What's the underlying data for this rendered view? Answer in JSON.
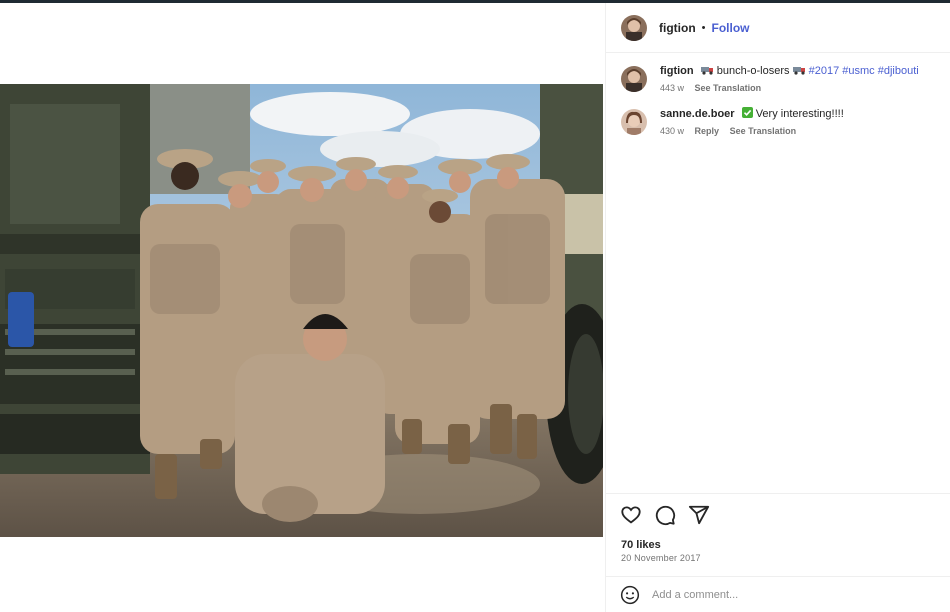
{
  "header": {
    "username": "figtion",
    "separator": "•",
    "follow_label": "Follow"
  },
  "comments": [
    {
      "username": "figtion",
      "emoji_before": "truck-emoji",
      "text": "bunch-o-losers",
      "emoji_after": "truck-emoji",
      "hashtags": [
        "#2017",
        "#usmc",
        "#djibouti"
      ],
      "age": "443 w",
      "see_translation": "See Translation"
    },
    {
      "username": "sanne.de.boer",
      "emoji_before": "check-mark-emoji",
      "text": "Very interesting!!!!",
      "age": "430 w",
      "reply": "Reply",
      "see_translation": "See Translation"
    }
  ],
  "post": {
    "likes": "70 likes",
    "date": "20 November 2017"
  },
  "add_comment": {
    "placeholder": "Add a comment..."
  },
  "colors": {
    "link": "#4a5fd1",
    "emoji_green": "#45b035",
    "muted_text": "#737373"
  }
}
